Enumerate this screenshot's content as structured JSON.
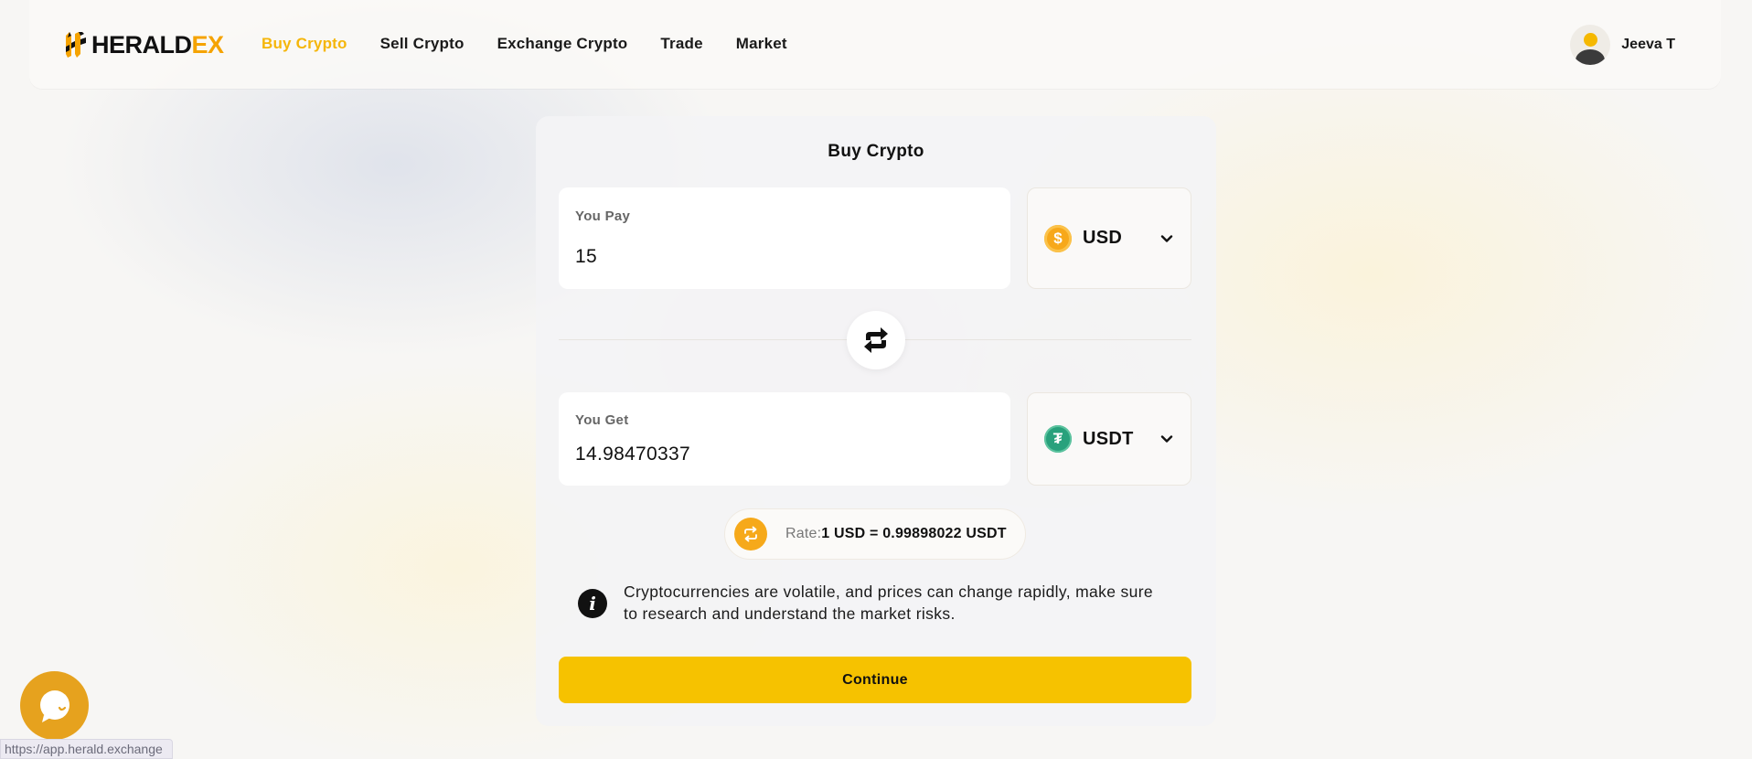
{
  "brand": {
    "part1": "HERALD",
    "part2": "EX",
    "accent_color": "#f5a300"
  },
  "nav": {
    "items": [
      {
        "label": "Buy Crypto",
        "active": true
      },
      {
        "label": "Sell Crypto",
        "active": false
      },
      {
        "label": "Exchange Crypto",
        "active": false
      },
      {
        "label": "Trade",
        "active": false
      },
      {
        "label": "Market",
        "active": false
      }
    ]
  },
  "user": {
    "name": "Jeeva T",
    "avatar_icon": "user-avatar-icon"
  },
  "card": {
    "title": "Buy Crypto",
    "pay": {
      "label": "You Pay",
      "value": "15",
      "currency": "USD",
      "currency_icon": "dollar-coin-icon"
    },
    "get": {
      "label": "You Get",
      "value": "14.98470337",
      "currency": "USDT",
      "currency_icon": "tether-coin-icon"
    },
    "swap_icon": "swap-arrows-icon",
    "rate": {
      "prefix": "Rate:",
      "value": "1 USD = 0.99898022 USDT",
      "icon": "exchange-rate-icon"
    },
    "notice": {
      "icon": "info-icon",
      "text": "Cryptocurrencies are volatile, and prices can change rapidly, make sure to research and understand the market risks."
    },
    "continue_label": "Continue",
    "button_color": "#f6c200"
  },
  "chat": {
    "icon": "chat-bubble-icon",
    "color": "#e6a21e"
  },
  "status_bar": {
    "url": "https://app.herald.exchange"
  }
}
